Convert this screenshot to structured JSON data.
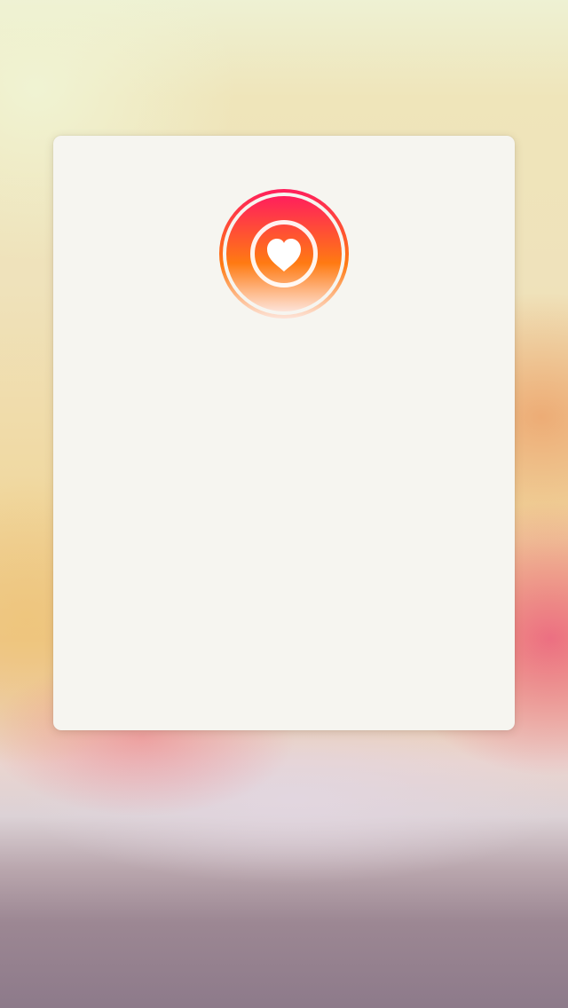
{
  "screen": {
    "name": "like-card-screen"
  },
  "card": {
    "icon": "heart-badge-icon",
    "colors": {
      "gradient_top": "#ff1f5c",
      "gradient_mid": "#ff7a12",
      "gradient_bottom": "#fde3d8",
      "card_background": "#f6f5f0",
      "heart": "#ffffff"
    }
  }
}
